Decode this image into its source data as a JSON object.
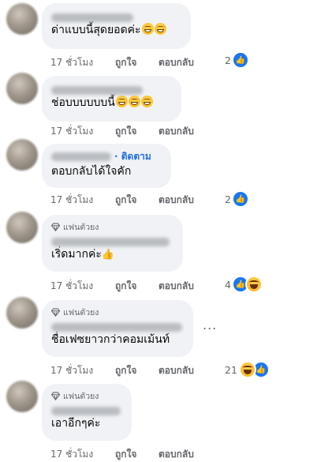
{
  "comments": [
    {
      "text": "ด่าแบบนี้สุดยอดค่ะ",
      "time": "17 ชั่วโมง",
      "like": "ถูกใจ",
      "reply": "ตอบกลับ",
      "reaction_count": "2"
    },
    {
      "text": "ช่อบบบบบบนี้",
      "time": "17 ชั่วโมง",
      "like": "ถูกใจ",
      "reply": "ตอบกลับ"
    },
    {
      "follow": "· ติดตาม",
      "text": "ตอบกลับได้ใจคัก",
      "time": "17 ชั่วโมง",
      "like": "ถูกใจ",
      "reply": "ตอบกลับ",
      "reaction_count": "2"
    },
    {
      "badge": "แฟนตัวยง",
      "text": "เริ่ดมากค่ะ",
      "time": "17 ชั่วโมง",
      "like": "ถูกใจ",
      "reply": "ตอบกลับ",
      "reaction_count": "4"
    },
    {
      "badge": "แฟนตัวยง",
      "text": "ชื่อเฟซยาวกว่าคอมเม้นท์",
      "time": "17 ชั่วโมง",
      "like": "ถูกใจ",
      "reply": "ตอบกลับ",
      "reaction_count": "21"
    },
    {
      "badge": "แฟนตัวยง",
      "text": "เอาอีกๆค่ะ",
      "time": "17 ชั่วโมง",
      "like": "ถูกใจ",
      "reply": "ตอบกลับ"
    }
  ],
  "more_options": "...",
  "icons": {
    "like_reaction": "thumbs-up-icon",
    "haha_reaction": "haha-icon",
    "badge": "diamond-icon"
  },
  "colors": {
    "like_blue": "#1877f2",
    "follow_blue": "#216fdb",
    "bubble_bg": "#f0f2f5",
    "meta_gray": "#65676b"
  }
}
